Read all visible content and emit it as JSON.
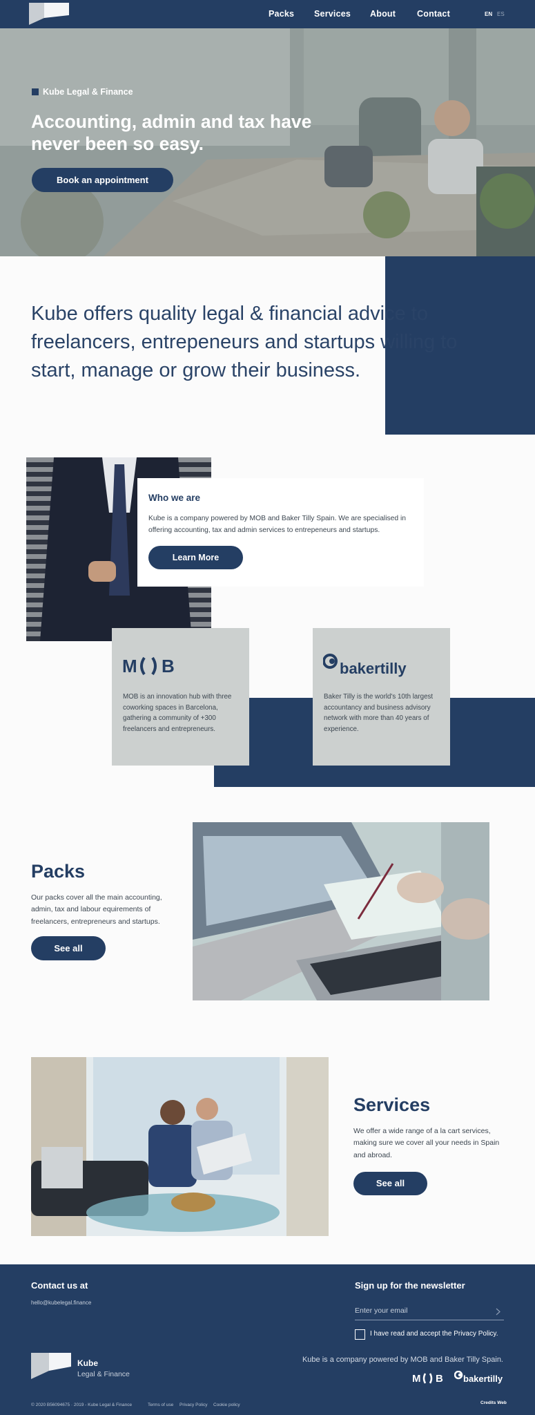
{
  "nav": {
    "links": [
      "Packs",
      "Services",
      "About",
      "Contact"
    ],
    "lang_en": "EN",
    "lang_es": "ES"
  },
  "hero": {
    "eyebrow": "Kube Legal & Finance",
    "title": "Accounting, admin and tax have never been so easy.",
    "cta": "Book an appointment"
  },
  "intro": {
    "text": "Kube offers quality legal & financial advice to freelancers, entrepeneurs and startups willing to start, manage or grow their business."
  },
  "who": {
    "title": "Who we are",
    "text": "Kube is a company powered by MOB and Baker Tilly Spain. We are specialised in offering accounting, tax and admin services to entrepeneurs and startups.",
    "cta": "Learn More"
  },
  "partners": [
    {
      "logo": "M( )B",
      "text": "MOB is an innovation hub with three coworking spaces in Barcelona, gathering a community of +300 freelancers and entrepreneurs."
    },
    {
      "logo": "bakertilly",
      "text": "Baker Tilly is the world's 10th largest accountancy and business advisory network with more than 40 years of experience."
    }
  ],
  "packs": {
    "title": "Packs",
    "text": "Our packs cover all the main accounting, admin, tax and labour equirements of freelancers, entrepreneurs and startups.",
    "cta": "See all"
  },
  "services": {
    "title": "Services",
    "text": "We offer a wide range of a la cart services, making sure we cover all your needs in Spain and abroad.",
    "cta": "See all"
  },
  "footer": {
    "contact_title": "Contact us at",
    "email": "hello@kubelegal.finance",
    "newsletter_title": "Sign up for the newsletter",
    "email_placeholder": "Enter your email",
    "privacy_label": "I have read and accept the Privacy Policy.",
    "powered": "Kube is a company powered by MOB and Baker Tilly Spain.",
    "brand": "Kube",
    "brand_sub": "Legal & Finance",
    "copyright": "© 2020 B56094675 · 2019 - Kube Legal & Finance",
    "terms": "Terms of use",
    "privacy": "Privacy Policy",
    "cookie": "Cookie policy",
    "credits": "Credits Web",
    "mob_logo": "M( )B",
    "baker_logo": "bakertilly"
  },
  "colors": {
    "primary": "#243e63",
    "card_gray": "#ccd0cf",
    "background": "#fbfbfb"
  }
}
